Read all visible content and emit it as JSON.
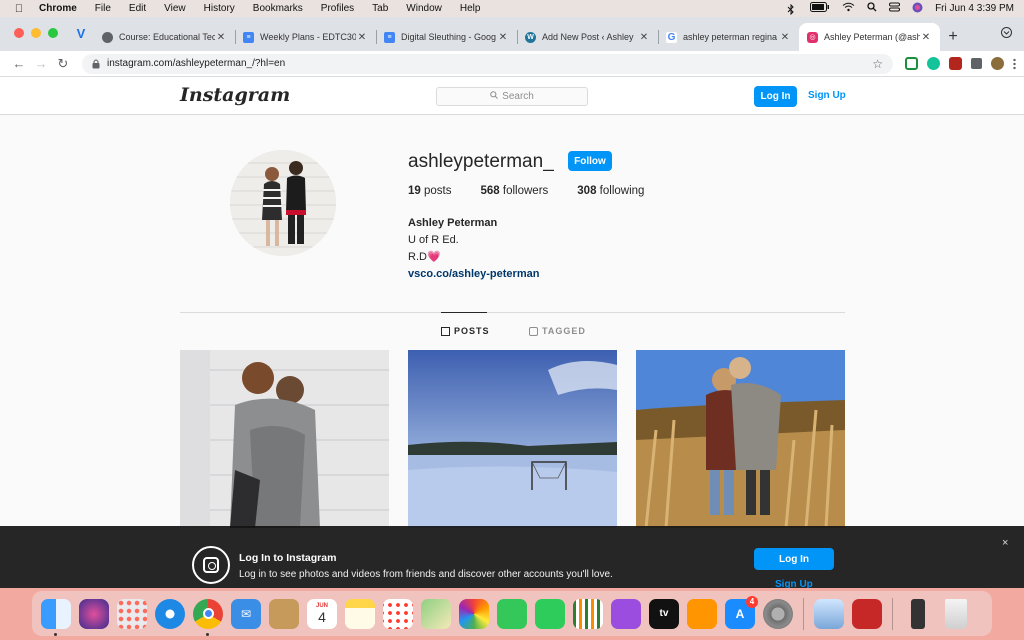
{
  "menubar": {
    "app_name": "Chrome",
    "items": [
      "File",
      "Edit",
      "View",
      "History",
      "Bookmarks",
      "Profiles",
      "Tab",
      "Window",
      "Help"
    ],
    "clock": "Fri Jun 4  3:39 PM"
  },
  "tabs": [
    {
      "title": "Course: Educational Tec",
      "favicon": "globe-icon",
      "color": "#5f6368"
    },
    {
      "title": "Weekly Plans - EDTC300",
      "favicon": "docs-icon",
      "color": "#4285f4"
    },
    {
      "title": "Digital Sleuthing - Goog",
      "favicon": "docs-icon",
      "color": "#4285f4"
    },
    {
      "title": "Add New Post ‹ Ashley",
      "favicon": "wordpress-icon",
      "color": "#21759b"
    },
    {
      "title": "ashley peterman regina",
      "favicon": "google-icon",
      "color": "#ea4335"
    },
    {
      "title": "Ashley Peterman (@ash",
      "favicon": "instagram-icon",
      "color": "#e1306c"
    }
  ],
  "url": "instagram.com/ashleypeterman_/?hl=en",
  "instagram": {
    "logo": "Instagram",
    "search_placeholder": "Search",
    "login_label": "Log In",
    "signup_label": "Sign Up",
    "profile": {
      "username": "ashleypeterman_",
      "follow_label": "Follow",
      "posts_count": "19",
      "posts_label": "posts",
      "followers_count": "568",
      "followers_label": "followers",
      "following_count": "308",
      "following_label": "following",
      "full_name": "Ashley Peterman",
      "bio_line1": "U of R Ed.",
      "bio_line2": "R.D",
      "bio_heart": "💗",
      "link": "vsco.co/ashley-peterman"
    },
    "tabs": {
      "posts": "POSTS",
      "tagged": "TAGGED"
    },
    "banner": {
      "title": "Log In to Instagram",
      "description": "Log in to see photos and videos from friends and discover other accounts you'll love.",
      "login_label": "Log In",
      "signup_label": "Sign Up",
      "close": "×"
    }
  },
  "dock": {
    "calendar_month": "JUN",
    "calendar_day": "4",
    "appstore_badge": "4",
    "tv_label": "tv"
  },
  "colors": {
    "ig_blue": "#0095f6",
    "link_blue": "#00376b"
  }
}
